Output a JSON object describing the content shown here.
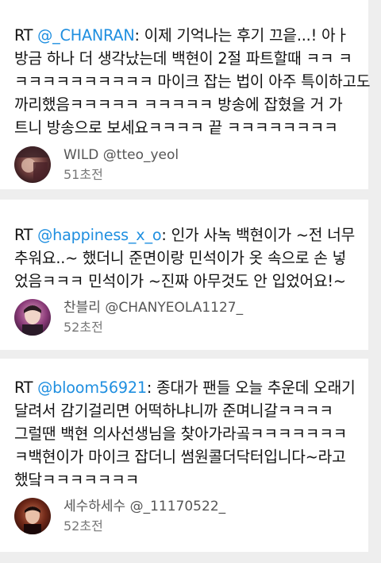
{
  "tweets": [
    {
      "prefix": "RT ",
      "mention": "@_CHANRAN",
      "lines": [
        ": 이제 기억나는 후기 끄읕...! 아ㅏ",
        "방금 하나 더 생각났는데 백현이 2절 파트할때 ㅋㅋ ㅋ",
        "ㅋㅋㅋㅋㅋㅋㅋㅋㅋㅋ 마이크 잡는 법이 아주 특이하고도",
        "까리했음ㅋㅋㅋㅋㅋ ㅋㅋㅋㅋㅋ 방송에 잡혔을 거 가",
        "트니 방송으로 보세요ㅋㅋㅋㅋ 끝 ㅋㅋㅋㅋㅋㅋㅋㅋ"
      ],
      "author": "WILD @tteo_yeol",
      "time": "51초전"
    },
    {
      "prefix": "RT ",
      "mention": "@happiness_x_o",
      "lines": [
        ": 인가 사녹 백현이가 ~전 너무",
        "추워요..~ 했더니 준면이랑 민석이가 옷 속으로 손 넣",
        "었음ㅋㅋㅋ 민석이가 ~진짜 아무것도 안 입었어요!~"
      ],
      "author": "찬블리 @CHANYEOLA1127_",
      "time": "52초전"
    },
    {
      "prefix": "RT ",
      "mention": "@bloom56921",
      "lines": [
        ": 종대가 팬들 오늘 추운데 오래기",
        "달려서 감기걸리면 어떡하냐니까 준며니갈ㅋㅋㅋㅋ",
        "그럴땐 백현 의사선생님을 찾아가라곸ㅋㅋㅋㅋㅋㅋㅋ",
        "ㅋ백현이가 마이크 잡더니 썸원콜더닥터입니다~라고",
        "했닼ㅋㅋㅋㅋㅋㅋㅋ"
      ],
      "author": "세수하세수 @_11170522_",
      "time": "52초전"
    }
  ],
  "colors": {
    "mention": "#1f8fe0",
    "text": "#111111",
    "meta": "#777777",
    "background": "#eeeeee",
    "card": "#ffffff"
  },
  "icons": [
    "avatar-wild",
    "avatar-chanbly",
    "avatar-sesu"
  ]
}
